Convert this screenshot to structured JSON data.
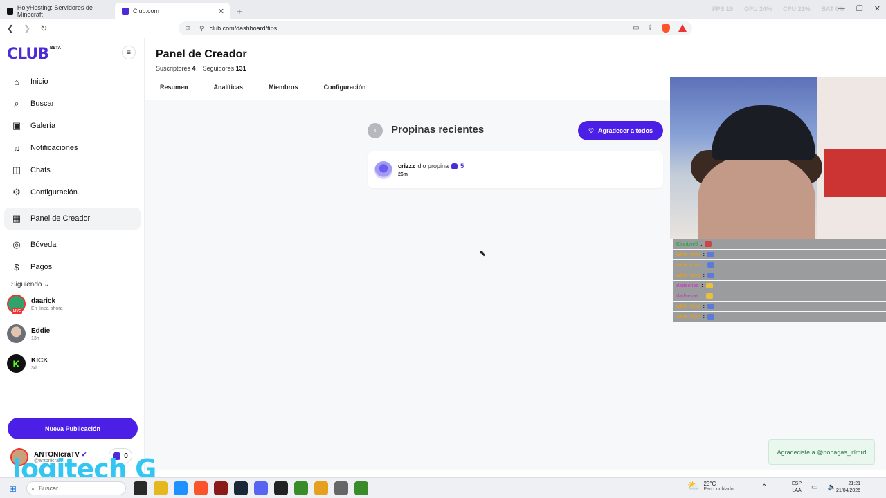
{
  "browser": {
    "tabs": [
      {
        "label": "HolyHosting: Servidores de Minecraft",
        "fav_color": "#111"
      },
      {
        "label": "Club.com",
        "fav_color": "#4c2bd9"
      }
    ],
    "perf": {
      "fps_label": "FPS",
      "fps": "19",
      "gpu_label": "GPU",
      "gpu": "24%",
      "cpu_label": "CPU",
      "cpu": "21%",
      "bat_label": "BAT",
      "bat": "0%"
    },
    "url": "club.com/dashboard/tips"
  },
  "sidebar": {
    "logo": "CLUB",
    "beta": "BETA",
    "items": [
      {
        "label": "Inicio",
        "icon": "home-icon",
        "glyph": "⌂"
      },
      {
        "label": "Buscar",
        "icon": "search-icon",
        "glyph": "⌕"
      },
      {
        "label": "Galería",
        "icon": "gallery-icon",
        "glyph": "▣"
      },
      {
        "label": "Notificaciones",
        "icon": "bell-icon",
        "glyph": "♫"
      },
      {
        "label": "Chats",
        "icon": "chat-icon",
        "glyph": "◫"
      },
      {
        "label": "Configuración",
        "icon": "gear-icon",
        "glyph": "⚙"
      },
      {
        "label": "Panel de Creador",
        "icon": "dashboard-icon",
        "glyph": "▦"
      },
      {
        "label": "Bóveda",
        "icon": "vault-icon",
        "glyph": "◎"
      },
      {
        "label": "Pagos",
        "icon": "dollar-icon",
        "glyph": "$"
      }
    ],
    "following_header": "Siguiendo",
    "following": [
      {
        "name": "daarick",
        "sub": "En línea ahora",
        "live": "LIVE"
      },
      {
        "name": "Eddie",
        "sub": "13h"
      },
      {
        "name": "KICK",
        "sub": "3d"
      }
    ],
    "new_post": "Nueva Publicación",
    "me": {
      "name": "ANTONIcraTV",
      "handle": "@antonicratv",
      "coins": "0"
    }
  },
  "main": {
    "title": "Panel de Creador",
    "subs_label": "Suscriptores",
    "subs": "4",
    "followers_label": "Seguidores",
    "followers": "131",
    "tabs": [
      "Resumen",
      "Analíticas",
      "Miembros",
      "Configuración"
    ],
    "tips_title": "Propinas recientes",
    "thank_all": "Agradecer a todos",
    "tip": {
      "user": "crizzz",
      "action": "dio propina",
      "amount": "5",
      "time": "26m"
    }
  },
  "overlay": {
    "chat": [
      {
        "name": "Kinotwell",
        "sep": ":",
        "color": "#2ea84a",
        "icon_color": "#c44"
      },
      {
        "name": "wtnk_foyo",
        "sep": ":",
        "color": "#e0a020",
        "icon_color": "#5a7bd8"
      },
      {
        "name": "wtnk_foyo",
        "sep": ":",
        "color": "#e0a020",
        "icon_color": "#5a7bd8"
      },
      {
        "name": "wtnk_foyo",
        "sep": ":",
        "color": "#e0a020",
        "icon_color": "#5a7bd8"
      },
      {
        "name": "dadsenas",
        "sep": ":",
        "color": "#c04ac0",
        "icon_color": "#e8c040"
      },
      {
        "name": "dadsenas",
        "sep": ":",
        "color": "#c04ac0",
        "icon_color": "#e8c040"
      },
      {
        "name": "wtnk_foyo",
        "sep": ":",
        "color": "#e0a020",
        "icon_color": "#5a7bd8"
      },
      {
        "name": "wtnk_foyo",
        "sep": ":",
        "color": "#e0a020",
        "icon_color": "#5a7bd8"
      }
    ],
    "toast": "Agradeciste a @nohagas_irlmrd",
    "watermark": "logitech G"
  },
  "taskbar": {
    "search": "Buscar",
    "weather_temp": "23°C",
    "weather_desc": "Parc. nublado",
    "lang1": "ESP",
    "lang2": "LAA",
    "time": "21:21",
    "date": "21/04/2026",
    "apps": [
      "#2a2a2a",
      "#e6b820",
      "#1e90ff",
      "#fb542b",
      "#8b1a1a",
      "#1b2838",
      "#5865f2",
      "#222",
      "#3a8b2a",
      "#e6a020",
      "#666",
      "#3a8b2a"
    ]
  }
}
